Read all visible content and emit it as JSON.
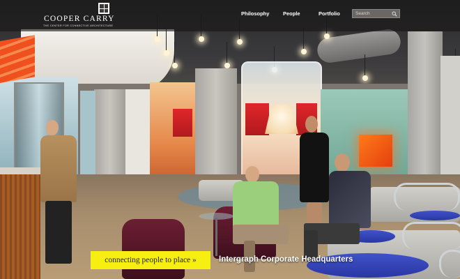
{
  "brand": {
    "name": "COOPER CARRY",
    "tagline": "THE CENTER FOR CONNECTIVE ARCHITECTURE",
    "logo_icon": "cc-logo-icon"
  },
  "nav": {
    "items": [
      {
        "label": "Philosophy"
      },
      {
        "label": "People"
      },
      {
        "label": "Portfolio"
      }
    ],
    "search": {
      "placeholder": "Search",
      "icon": "search-icon"
    }
  },
  "hero": {
    "description_icon": "office-lobby-photo",
    "cta_label": "connecting people to place »",
    "project_title": "Intergraph Corporate Headquarters",
    "colors": {
      "cta_background": "#f7ef12",
      "topbar": "#191716"
    }
  }
}
